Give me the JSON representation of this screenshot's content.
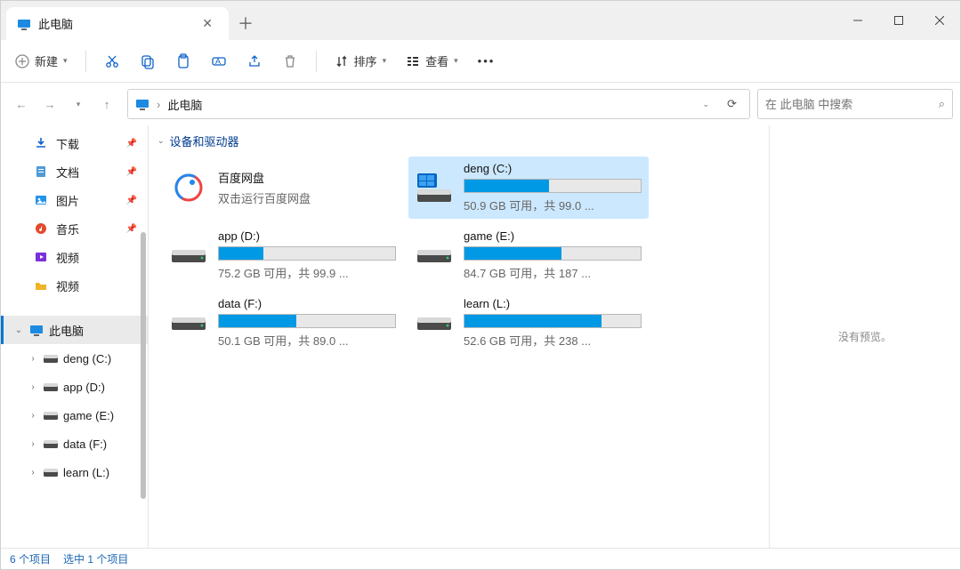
{
  "window": {
    "tab_title": "此电脑",
    "new_tab_tooltip": "+"
  },
  "toolbar": {
    "new_label": "新建",
    "sort_label": "排序",
    "view_label": "查看"
  },
  "address": {
    "root_label": "此电脑"
  },
  "search": {
    "placeholder": "在 此电脑 中搜索"
  },
  "sidebar_quick": [
    {
      "icon": "download",
      "label": "下载",
      "pinned": true,
      "color": "#0d62c9"
    },
    {
      "icon": "document",
      "label": "文档",
      "pinned": true,
      "color": "#4f9ad8"
    },
    {
      "icon": "image",
      "label": "图片",
      "pinned": true,
      "color": "#2293e8"
    },
    {
      "icon": "music",
      "label": "音乐",
      "pinned": true,
      "color": "#e24a2b"
    },
    {
      "icon": "video",
      "label": "视频",
      "pinned": false,
      "color": "#7b2fdb"
    },
    {
      "icon": "folder",
      "label": "视频",
      "pinned": false,
      "color": "#f0b429"
    }
  ],
  "sidebar_tree": {
    "root_label": "此电脑",
    "children": [
      {
        "label": "deng (C:)"
      },
      {
        "label": "app (D:)"
      },
      {
        "label": "game (E:)"
      },
      {
        "label": "data (F:)"
      },
      {
        "label": "learn (L:)"
      }
    ]
  },
  "group_header": "设备和驱动器",
  "special_tile": {
    "name": "百度网盘",
    "subtitle": "双击运行百度网盘"
  },
  "drives": [
    {
      "id": "c",
      "name": "deng (C:)",
      "free": "50.9 GB 可用，共 99.0 ...",
      "used_pct": 48,
      "selected": true,
      "system": true
    },
    {
      "id": "d",
      "name": "app (D:)",
      "free": "75.2 GB 可用，共 99.9 ...",
      "used_pct": 25,
      "selected": false,
      "system": false
    },
    {
      "id": "e",
      "name": "game (E:)",
      "free": "84.7 GB 可用，共 187 ...",
      "used_pct": 55,
      "selected": false,
      "system": false
    },
    {
      "id": "f",
      "name": "data (F:)",
      "free": "50.1 GB 可用，共 89.0 ...",
      "used_pct": 44,
      "selected": false,
      "system": false
    },
    {
      "id": "l",
      "name": "learn (L:)",
      "free": "52.6 GB 可用，共 238 ...",
      "used_pct": 78,
      "selected": false,
      "system": false
    }
  ],
  "preview": {
    "empty_text": "没有预览。"
  },
  "statusbar": {
    "item_count": "6 个项目",
    "selection": "选中 1 个项目"
  }
}
